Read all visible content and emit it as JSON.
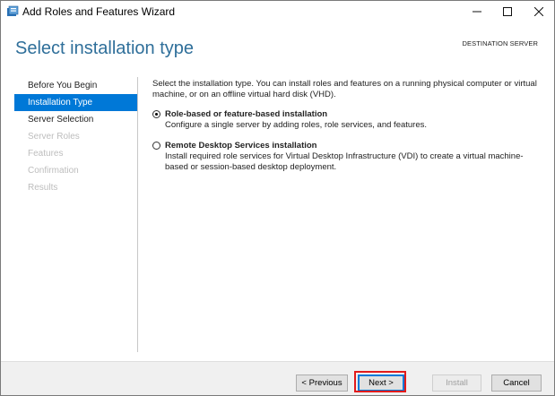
{
  "window": {
    "title": "Add Roles and Features Wizard",
    "icons": {
      "app": "server-manager-icon",
      "minimize": "minimize-icon",
      "maximize": "maximize-icon",
      "close": "close-icon"
    }
  },
  "header": {
    "page_title": "Select installation type",
    "destination_label": "DESTINATION SERVER"
  },
  "sidebar": {
    "items": [
      {
        "label": "Before You Begin",
        "state": "normal"
      },
      {
        "label": "Installation Type",
        "state": "active"
      },
      {
        "label": "Server Selection",
        "state": "normal"
      },
      {
        "label": "Server Roles",
        "state": "disabled"
      },
      {
        "label": "Features",
        "state": "disabled"
      },
      {
        "label": "Confirmation",
        "state": "disabled"
      },
      {
        "label": "Results",
        "state": "disabled"
      }
    ]
  },
  "main": {
    "intro": "Select the installation type. You can install roles and features on a running physical computer or virtual machine, or on an offline virtual hard disk (VHD).",
    "options": [
      {
        "title": "Role-based or feature-based installation",
        "description": "Configure a single server by adding roles, role services, and features.",
        "selected": true
      },
      {
        "title": "Remote Desktop Services installation",
        "description": "Install required role services for Virtual Desktop Infrastructure (VDI) to create a virtual machine-based or session-based desktop deployment.",
        "selected": false
      }
    ]
  },
  "footer": {
    "previous_label": "< Previous",
    "next_label": "Next >",
    "install_label": "Install",
    "cancel_label": "Cancel"
  },
  "colors": {
    "accent": "#0078d7",
    "title": "#2f6f9a",
    "highlight": "#e21b1b"
  }
}
